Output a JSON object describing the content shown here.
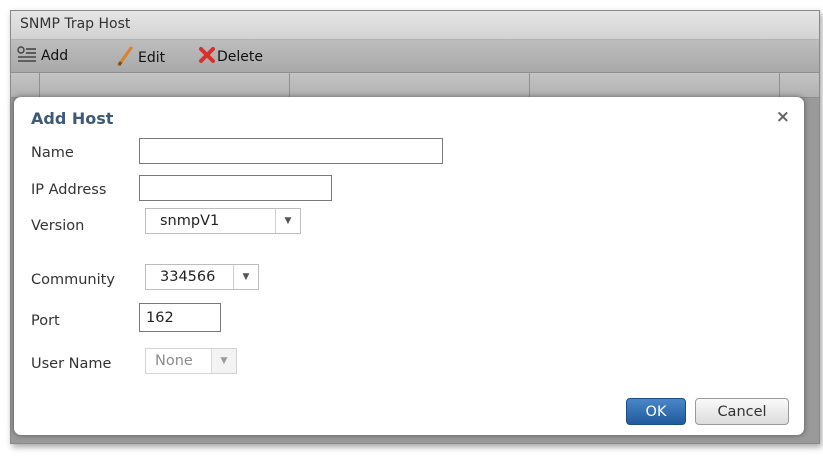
{
  "panel": {
    "title": "SNMP Trap Host"
  },
  "toolbar": {
    "add_label": "Add",
    "edit_label": "Edit",
    "delete_label": "Delete"
  },
  "dialog": {
    "title": "Add Host",
    "close_symbol": "×",
    "fields": {
      "name": {
        "label": "Name",
        "value": ""
      },
      "ip": {
        "label": "IP Address",
        "value": ""
      },
      "version": {
        "label": "Version",
        "selected": "snmpV1"
      },
      "community": {
        "label": "Community",
        "selected": "334566"
      },
      "port": {
        "label": "Port",
        "value": "162"
      },
      "username": {
        "label": "User Name",
        "selected": "None",
        "disabled": true
      }
    },
    "ok_label": "OK",
    "cancel_label": "Cancel"
  },
  "icons": {
    "add": "add-list-icon",
    "edit": "pencil-icon",
    "delete": "red-x-icon",
    "dropdown": "triangle-down-icon",
    "close": "close-icon"
  },
  "colors": {
    "dialog_title": "#3e5a78",
    "ok_button": "#2b6cb0",
    "delete_icon": "#d9302a",
    "edit_icon": "#d9822b"
  }
}
